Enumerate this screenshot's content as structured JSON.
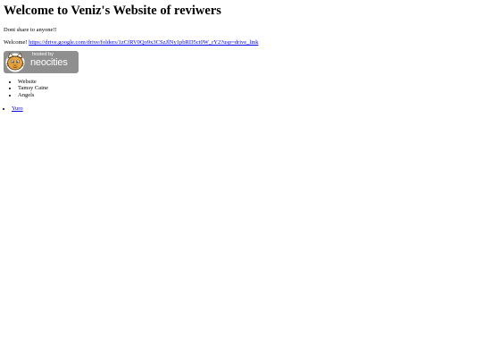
{
  "header": {
    "title": "Welcome to Veniz's Website of reviwers"
  },
  "content": {
    "warning": "Dont share to anyone!!",
    "welcome_label": "Welcome!",
    "drive_link_text": "https://drive.google.com/drive/folders/1zCfRV0Qo9x3CSzJlNy1pbRD5ct0W_rY2?usp=drive_link"
  },
  "badge": {
    "small_text": "hosted by",
    "brand_text": "neocities",
    "icon": "neocities-cat-icon",
    "background_color": "#8f8f8f",
    "accent_color": "#e8a33d"
  },
  "names_list": {
    "items": [
      "Website",
      "Tamsy Caine",
      "Angels"
    ]
  },
  "nav_links": {
    "items": [
      "Yuro"
    ]
  },
  "colors": {
    "link": "#0000ee",
    "text": "#000000",
    "background": "#ffffff"
  }
}
